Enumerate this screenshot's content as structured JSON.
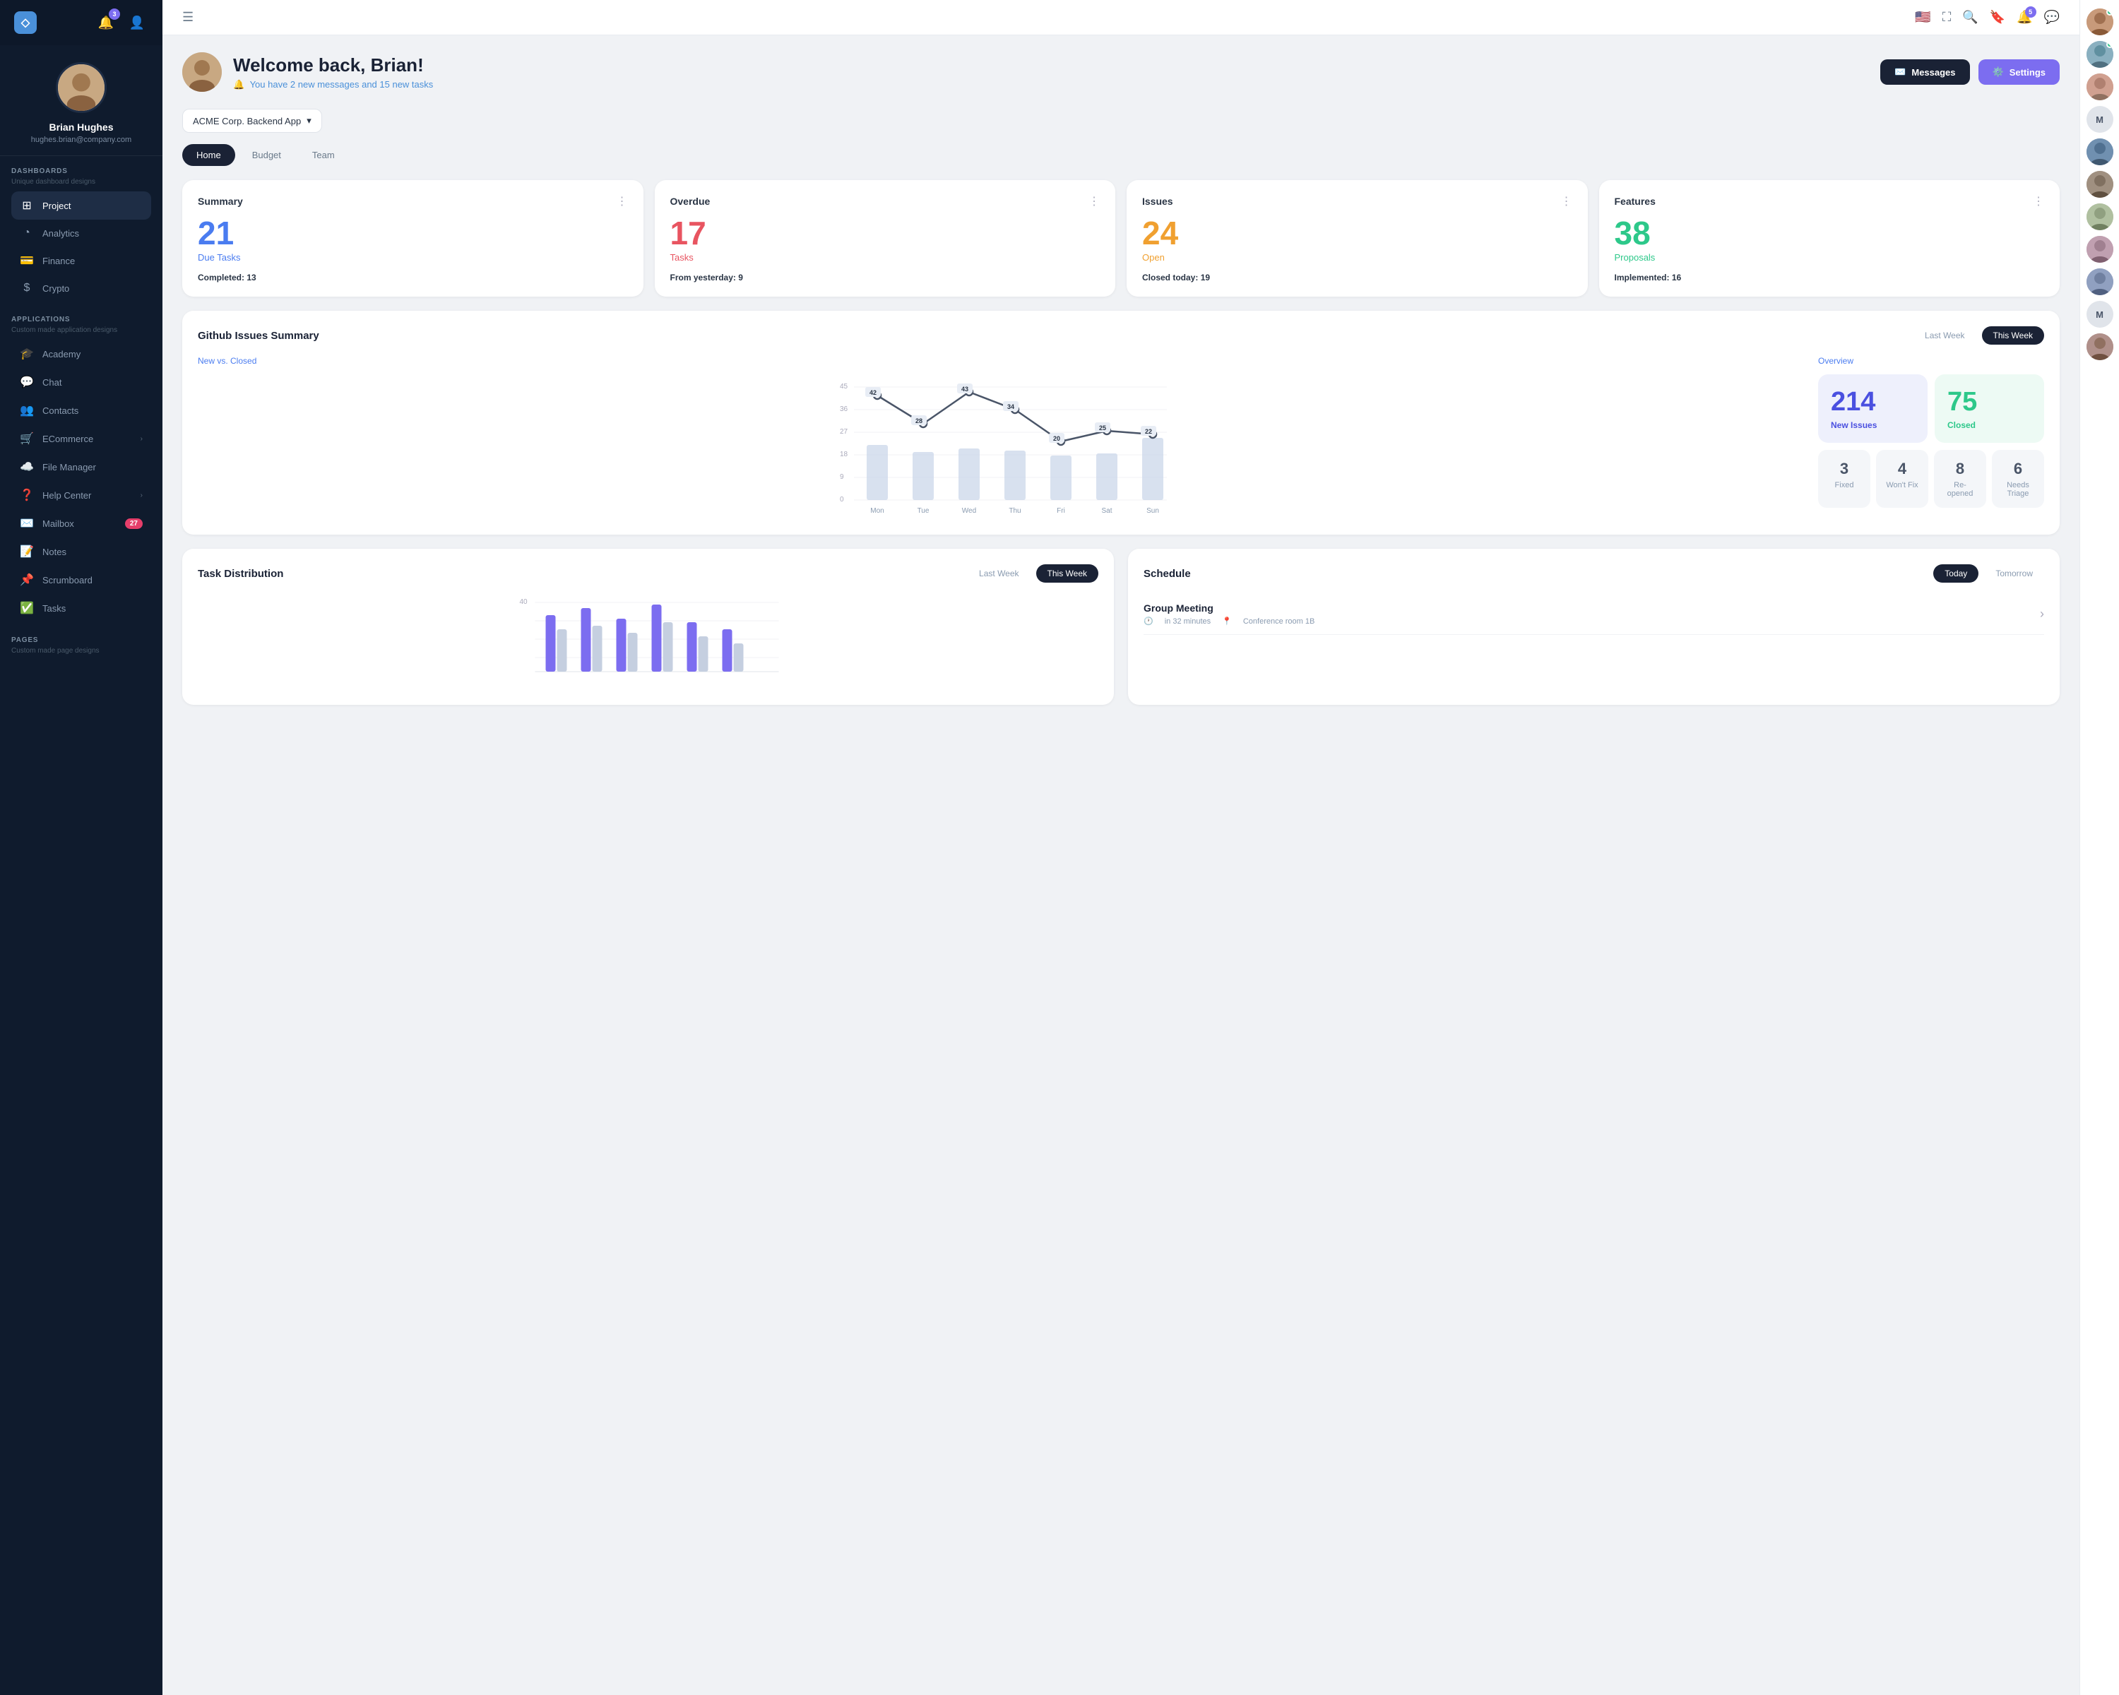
{
  "sidebar": {
    "logo": "◇",
    "notification_count": "3",
    "profile": {
      "name": "Brian Hughes",
      "email": "hughes.brian@company.com"
    },
    "dashboards_label": "DASHBOARDS",
    "dashboards_sub": "Unique dashboard designs",
    "dashboard_items": [
      {
        "label": "Project",
        "icon": "📋",
        "active": true
      },
      {
        "label": "Analytics",
        "icon": "📊"
      },
      {
        "label": "Finance",
        "icon": "💳"
      },
      {
        "label": "Crypto",
        "icon": "💰"
      }
    ],
    "applications_label": "APPLICATIONS",
    "applications_sub": "Custom made application designs",
    "app_items": [
      {
        "label": "Academy",
        "icon": "🎓"
      },
      {
        "label": "Chat",
        "icon": "💬"
      },
      {
        "label": "Contacts",
        "icon": "👥"
      },
      {
        "label": "ECommerce",
        "icon": "🛒",
        "has_chevron": true
      },
      {
        "label": "File Manager",
        "icon": "☁️"
      },
      {
        "label": "Help Center",
        "icon": "❓",
        "has_chevron": true
      },
      {
        "label": "Mailbox",
        "icon": "✉️",
        "badge": "27"
      },
      {
        "label": "Notes",
        "icon": "📝"
      },
      {
        "label": "Scrumboard",
        "icon": "📌"
      },
      {
        "label": "Tasks",
        "icon": "✅"
      }
    ],
    "pages_label": "PAGES",
    "pages_sub": "Custom made page designs"
  },
  "topbar": {
    "flag_icon": "🇺🇸",
    "fullscreen_icon": "⛶",
    "search_icon": "🔍",
    "bookmark_icon": "🔖",
    "notifications_icon": "🔔",
    "notifications_badge": "5",
    "messages_icon": "💬"
  },
  "welcome": {
    "greeting": "Welcome back, Brian!",
    "subtitle": "You have 2 new messages and 15 new tasks",
    "messages_btn": "Messages",
    "settings_btn": "Settings"
  },
  "project_selector": {
    "label": "ACME Corp. Backend App"
  },
  "tabs": [
    {
      "label": "Home",
      "active": true
    },
    {
      "label": "Budget"
    },
    {
      "label": "Team"
    }
  ],
  "stats": [
    {
      "title": "Summary",
      "number": "21",
      "number_label": "Due Tasks",
      "number_color": "blue",
      "footer_pre": "Completed:",
      "footer_val": "13"
    },
    {
      "title": "Overdue",
      "number": "17",
      "number_label": "Tasks",
      "number_color": "red",
      "footer_pre": "From yesterday:",
      "footer_val": "9"
    },
    {
      "title": "Issues",
      "number": "24",
      "number_label": "Open",
      "number_color": "orange",
      "footer_pre": "Closed today:",
      "footer_val": "19"
    },
    {
      "title": "Features",
      "number": "38",
      "number_label": "Proposals",
      "number_color": "green",
      "footer_pre": "Implemented:",
      "footer_val": "16"
    }
  ],
  "github_issues": {
    "title": "Github Issues Summary",
    "last_week_btn": "Last Week",
    "this_week_btn": "This Week",
    "chart_label": "New vs. Closed",
    "overview_label": "Overview",
    "chart_data": {
      "days": [
        "Mon",
        "Tue",
        "Wed",
        "Thu",
        "Fri",
        "Sat",
        "Sun"
      ],
      "line_values": [
        42,
        28,
        43,
        34,
        20,
        25,
        22
      ],
      "bar_heights": [
        70,
        55,
        60,
        65,
        45,
        55,
        80
      ]
    },
    "new_issues": "214",
    "new_issues_label": "New Issues",
    "closed": "75",
    "closed_label": "Closed",
    "small_stats": [
      {
        "num": "3",
        "label": "Fixed"
      },
      {
        "num": "4",
        "label": "Won't Fix"
      },
      {
        "num": "8",
        "label": "Re-opened"
      },
      {
        "num": "6",
        "label": "Needs Triage"
      }
    ]
  },
  "task_distribution": {
    "title": "Task Distribution",
    "last_week_btn": "Last Week",
    "this_week_btn": "This Week",
    "max_label": "40"
  },
  "schedule": {
    "title": "Schedule",
    "today_btn": "Today",
    "tomorrow_btn": "Tomorrow",
    "event_title": "Group Meeting",
    "event_time": "in 32 minutes",
    "event_location": "Conference room 1B"
  },
  "right_panel": {
    "avatars": [
      {
        "type": "image",
        "color": "#c89a7a",
        "online": true
      },
      {
        "type": "image",
        "color": "#8ab0c0",
        "online": true
      },
      {
        "type": "image",
        "color": "#d0a090"
      },
      {
        "type": "letter",
        "letter": "M"
      },
      {
        "type": "image",
        "color": "#7090b0"
      },
      {
        "type": "image",
        "color": "#a09080"
      },
      {
        "type": "image",
        "color": "#b0c0a0"
      },
      {
        "type": "image",
        "color": "#c0a0b0"
      },
      {
        "type": "image",
        "color": "#90a0c0"
      },
      {
        "type": "letter",
        "letter": "M"
      },
      {
        "type": "image",
        "color": "#b0908a"
      }
    ]
  }
}
